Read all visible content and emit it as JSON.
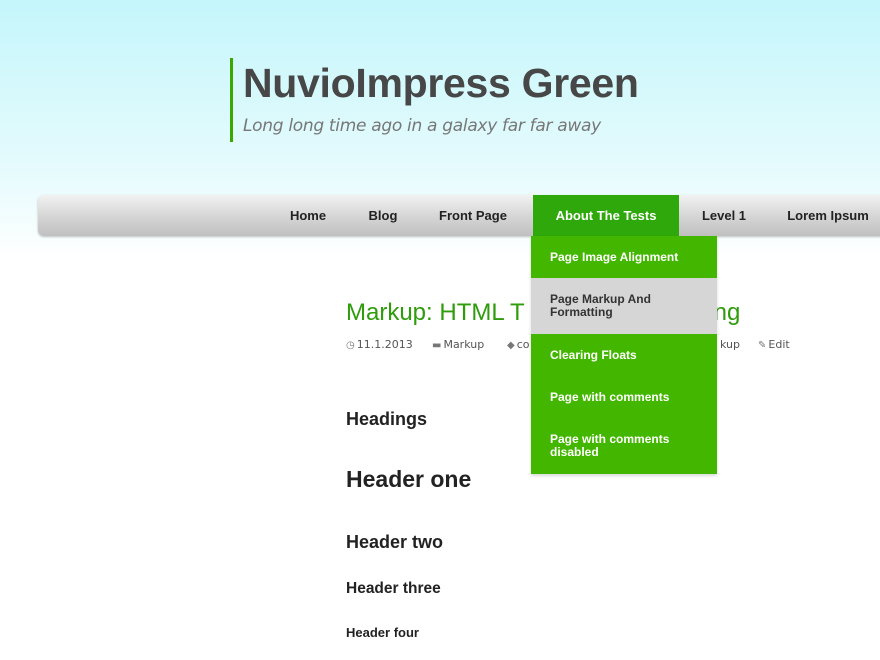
{
  "site": {
    "title": "NuvioImpress Green",
    "tagline": "Long long time ago in a galaxy far far away"
  },
  "nav": {
    "items": [
      {
        "label": "Home",
        "active": false
      },
      {
        "label": "Blog",
        "active": false
      },
      {
        "label": "Front Page",
        "active": false
      },
      {
        "label": "About The Tests",
        "active": true
      },
      {
        "label": "Level 1",
        "active": false
      },
      {
        "label": "Lorem Ipsum",
        "active": false
      }
    ],
    "dropdown": [
      {
        "label": "Page Image Alignment"
      },
      {
        "label": "Page Markup And Formatting",
        "hovered": true
      },
      {
        "label": "Clearing Floats"
      },
      {
        "label": "Page with comments"
      },
      {
        "label": "Page with comments disabled"
      }
    ]
  },
  "post": {
    "title_visible_start": "Markup: HTML T",
    "title_visible_end": "tting",
    "meta": {
      "date": "11.1.2013",
      "category": "Markup",
      "tag_partial": "co",
      "tag_partial_end": "kup",
      "edit": "Edit"
    }
  },
  "content": {
    "headings_label": "Headings",
    "h1": "Header one",
    "h2": "Header two",
    "h3": "Header three",
    "h4": "Header four"
  },
  "colors": {
    "accent_green": "#2ea80a",
    "dropdown_green": "#43b700",
    "hover_gray": "#d6d6d6",
    "title_gray": "#474747"
  }
}
